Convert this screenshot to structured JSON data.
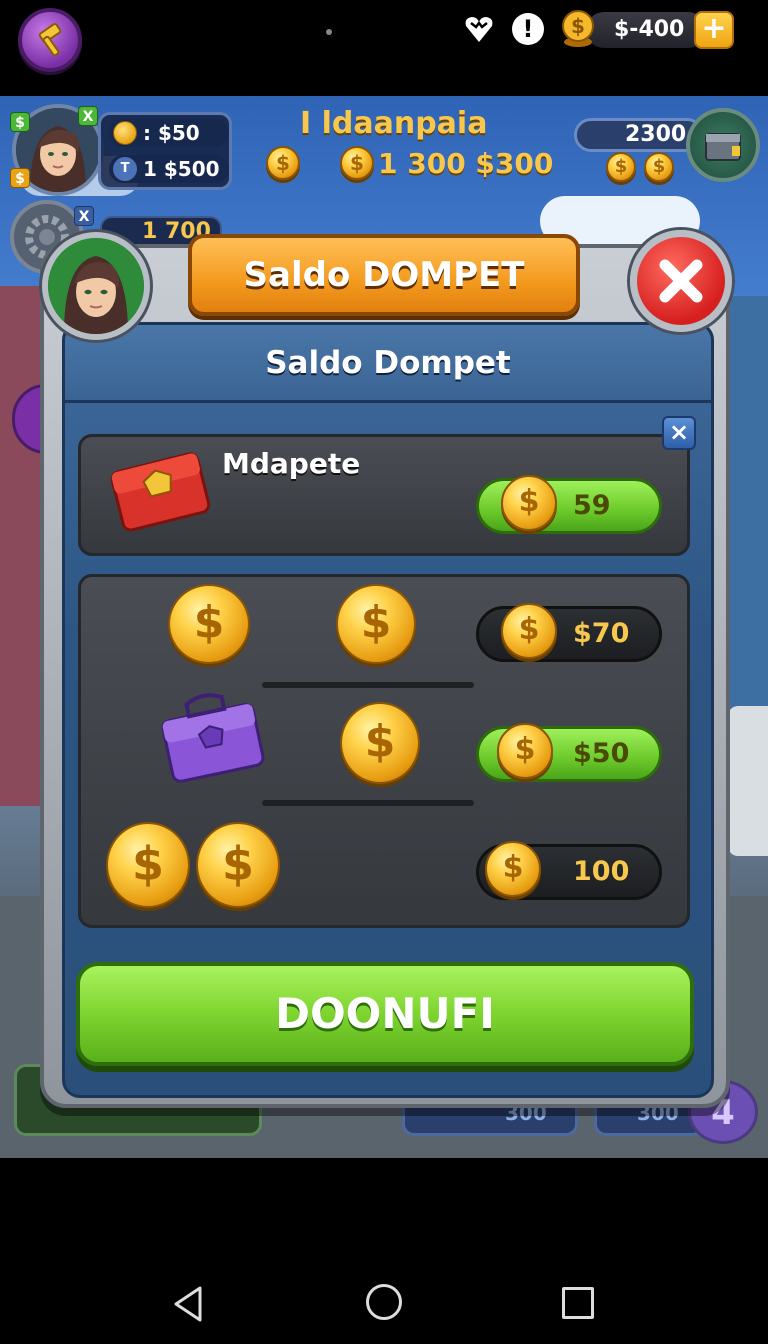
{
  "status_bar": {
    "balance": "$-400",
    "plus_label": "+",
    "alert_label": "!"
  },
  "hud": {
    "title": "I ldaanpaia",
    "center_stat": "1 300 $300",
    "stat_1": ": $50",
    "stat_2": "1 $500",
    "stat_2_icon_label": "T",
    "small_stat": "1 700",
    "right_stat": "2300",
    "badge_1": "$",
    "badge_2": "X",
    "badge_3": "$",
    "badge_4": "X",
    "bottom_stat_1": "300",
    "bottom_stat_2": "300",
    "bottom_right_label": "4"
  },
  "modal": {
    "title": "Saldo DOMPET",
    "subtitle": "Saldo Dompet",
    "card_close_label": "×",
    "wallet_label": "Mdapete",
    "rows": [
      {
        "value": "59",
        "style": "green"
      },
      {
        "value": "$70",
        "style": "dark"
      },
      {
        "value": "$50",
        "style": "green"
      },
      {
        "value": "100",
        "style": "dark"
      }
    ],
    "confirm_label": "DOONUFI"
  },
  "colors": {
    "accent_orange": "#f39a1e",
    "confirm_green": "#7ed42f",
    "close_red": "#d61f1f",
    "coin_gold": "#ffd24a"
  },
  "icons": [
    "hammer-icon",
    "heart-icon",
    "alert-icon",
    "coin-icon",
    "plus-icon",
    "close-icon",
    "wallet-icon",
    "chest-icon",
    "gear-icon",
    "back-icon",
    "home-icon",
    "recents-icon"
  ]
}
